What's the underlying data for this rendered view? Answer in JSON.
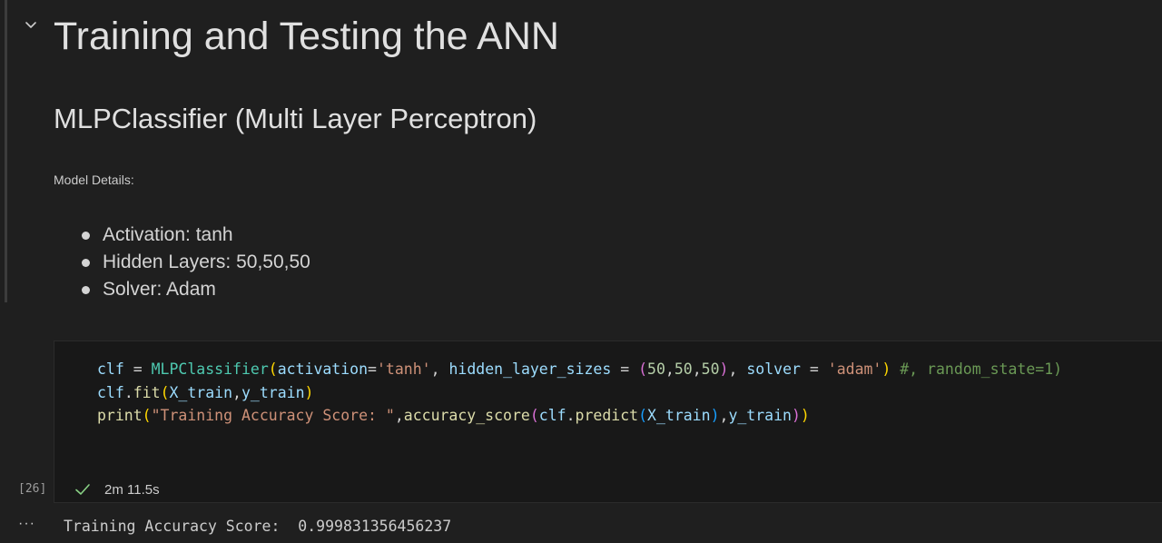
{
  "markdown_cell": {
    "heading1": "Training and Testing the ANN",
    "heading2": "MLPClassifier (Multi Layer Perceptron)",
    "paragraph": "Model Details:",
    "bullets": [
      "Activation: tanh",
      "Hidden Layers: 50,50,50",
      "Solver: Adam"
    ],
    "collapse_icon": "chevron-down-icon"
  },
  "code_cell": {
    "lines": [
      "clf = MLPClassifier(activation='tanh', hidden_layer_sizes = (50,50,50), solver = 'adam') #, random_state=1)",
      "clf.fit(X_train,y_train)",
      "print(\"Training Accuracy Score: \",accuracy_score(clf.predict(X_train),y_train))"
    ],
    "tokens": {
      "l1": {
        "clf": "clf",
        "eq": " = ",
        "cls": "MLPClassifier",
        "p1": "(",
        "kw1": "activation",
        "eq2": "=",
        "s1": "'tanh'",
        "c1": ", ",
        "kw2": "hidden_layer_sizes",
        "eq3": " = ",
        "p2": "(",
        "n1": "50",
        "c2": ",",
        "n2": "50",
        "c3": ",",
        "n3": "50",
        "p2c": ")",
        "c4": ", ",
        "kw3": "solver",
        "eq4": " = ",
        "s2": "'adam'",
        "p1c": ")",
        "sp": " ",
        "cmt": "#, random_state=1)"
      },
      "l2": {
        "clf": "clf",
        "dot": ".",
        "fn": "fit",
        "p1": "(",
        "a1": "X_train",
        "c1": ",",
        "a2": "y_train",
        "p1c": ")"
      },
      "l3": {
        "fn": "print",
        "p1": "(",
        "s1": "\"Training Accuracy Score: \"",
        "c1": ",",
        "fn2": "accuracy_score",
        "p2": "(",
        "clf": "clf",
        "dot": ".",
        "fn3": "predict",
        "p3": "(",
        "a1": "X_train",
        "p3c": ")",
        "c2": ",",
        "a2": "y_train",
        "p2c": ")",
        "p1c": ")"
      }
    },
    "execution_count": "[26]",
    "status_icon": "check-icon",
    "duration": "2m 11.5s"
  },
  "output": {
    "menu_icon": "ellipsis-icon",
    "menu_glyph": "···",
    "text": "Training Accuracy Score:  0.999831356456237"
  },
  "colors": {
    "background": "#1f1f1f",
    "code_background": "#181818",
    "success": "#89d185",
    "string": "#ce9178",
    "class": "#4ec9b0",
    "function": "#dcdcaa",
    "variable": "#9cdcfe",
    "number": "#b5cea8",
    "comment": "#6a9955"
  }
}
